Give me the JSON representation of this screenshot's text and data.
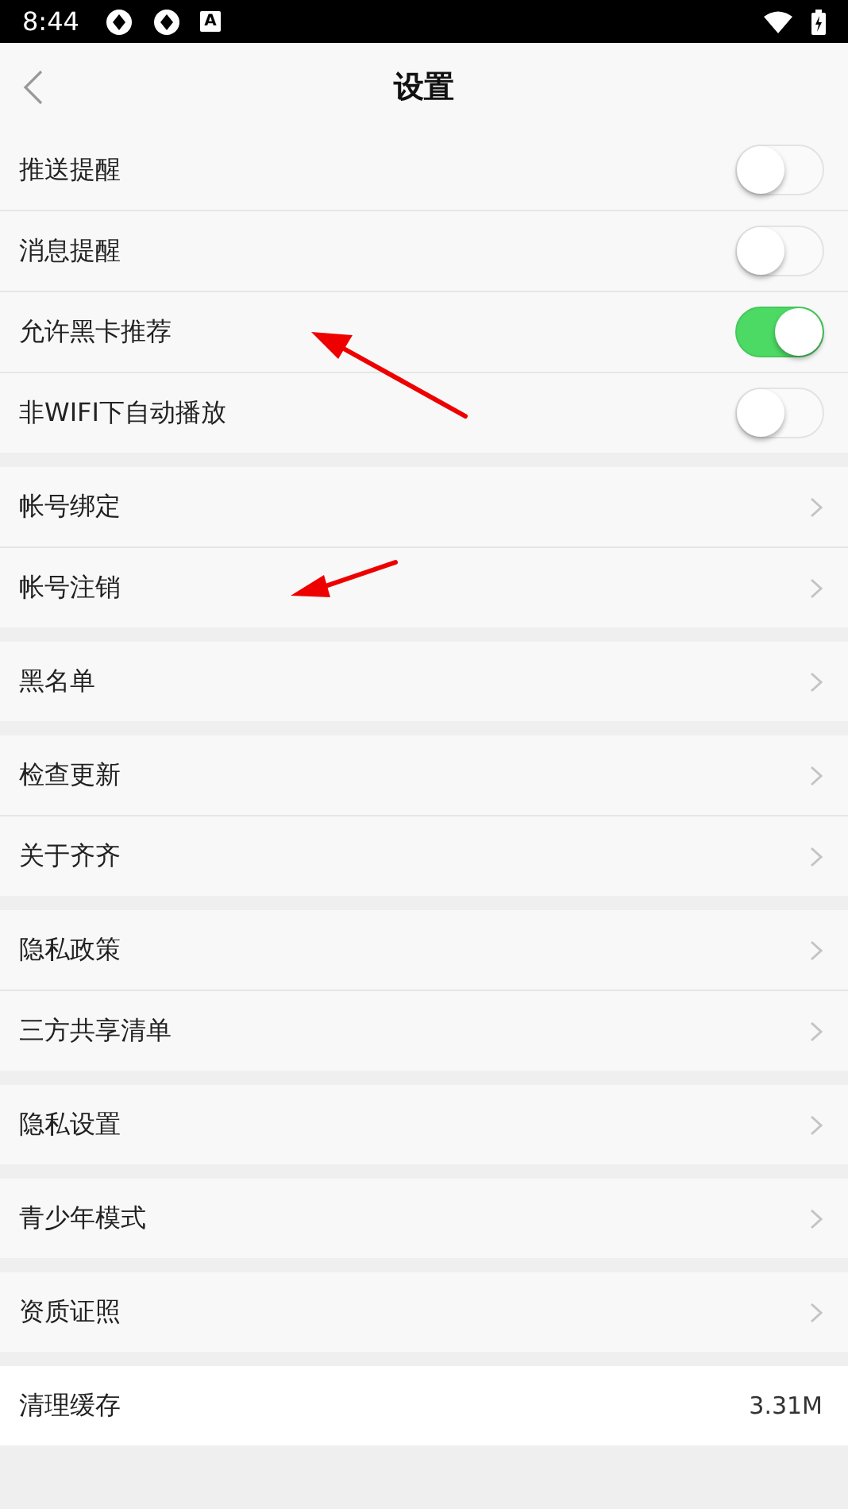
{
  "status_bar": {
    "time": "8:44",
    "notification_glyph": "A"
  },
  "header": {
    "title": "设置"
  },
  "sections": [
    {
      "items": [
        {
          "kind": "toggle",
          "label": "推送提醒",
          "on": false
        },
        {
          "kind": "toggle",
          "label": "消息提醒",
          "on": false
        },
        {
          "kind": "toggle",
          "label": "允许黑卡推荐",
          "on": true
        },
        {
          "kind": "toggle",
          "label": "非WIFI下自动播放",
          "on": false
        }
      ]
    },
    {
      "items": [
        {
          "kind": "link",
          "label": "帐号绑定"
        },
        {
          "kind": "link",
          "label": "帐号注销"
        }
      ]
    },
    {
      "items": [
        {
          "kind": "link",
          "label": "黑名单"
        }
      ]
    },
    {
      "items": [
        {
          "kind": "link",
          "label": "检查更新"
        },
        {
          "kind": "link",
          "label": "关于齐齐"
        }
      ]
    },
    {
      "items": [
        {
          "kind": "link",
          "label": "隐私政策"
        },
        {
          "kind": "link",
          "label": "三方共享清单"
        }
      ]
    },
    {
      "items": [
        {
          "kind": "link",
          "label": "隐私设置"
        }
      ]
    },
    {
      "items": [
        {
          "kind": "link",
          "label": "青少年模式"
        }
      ]
    },
    {
      "items": [
        {
          "kind": "link",
          "label": "资质证照"
        }
      ]
    },
    {
      "items": [
        {
          "kind": "value",
          "label": "清理缓存",
          "value": "3.31M"
        }
      ]
    }
  ]
}
